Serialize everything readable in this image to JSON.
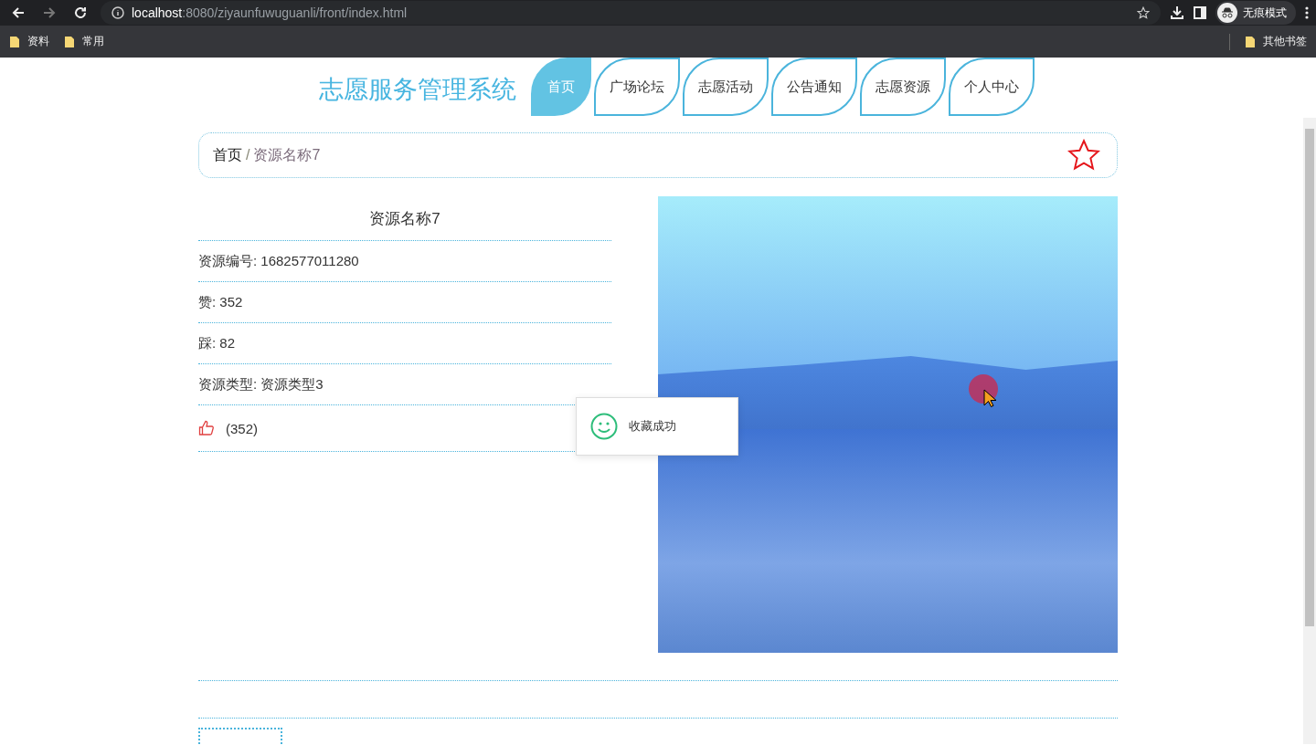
{
  "browser": {
    "nav_buttons": [
      {
        "kind": "back",
        "disabled": false
      },
      {
        "kind": "forward",
        "disabled": true
      },
      {
        "kind": "reload",
        "disabled": false
      }
    ],
    "url_host": "localhost",
    "url_path": ":8080/ziyaunfuwuguanli/front/index.html",
    "profile_label": "无痕模式",
    "bookmarks": [
      "资料",
      "常用"
    ],
    "other_bookmarks": "其他书签"
  },
  "site_title": "志愿服务管理系统",
  "nav": [
    {
      "label": "首页",
      "selected": true
    },
    {
      "label": "广场论坛",
      "selected": false
    },
    {
      "label": "志愿活动",
      "selected": false
    },
    {
      "label": "公告通知",
      "selected": false
    },
    {
      "label": "志愿资源",
      "selected": false
    },
    {
      "label": "个人中心",
      "selected": false
    }
  ],
  "breadcrumb": {
    "home": "首页",
    "separator": "/",
    "current": "资源名称7",
    "favorited": false
  },
  "detail": {
    "title": "资源名称7",
    "fields": [
      "资源编号: 1682577011280",
      "赞: 352",
      "踩: 82",
      "资源类型: 资源类型3"
    ],
    "like_count": "(352)"
  },
  "toast": {
    "message": "收藏成功"
  }
}
